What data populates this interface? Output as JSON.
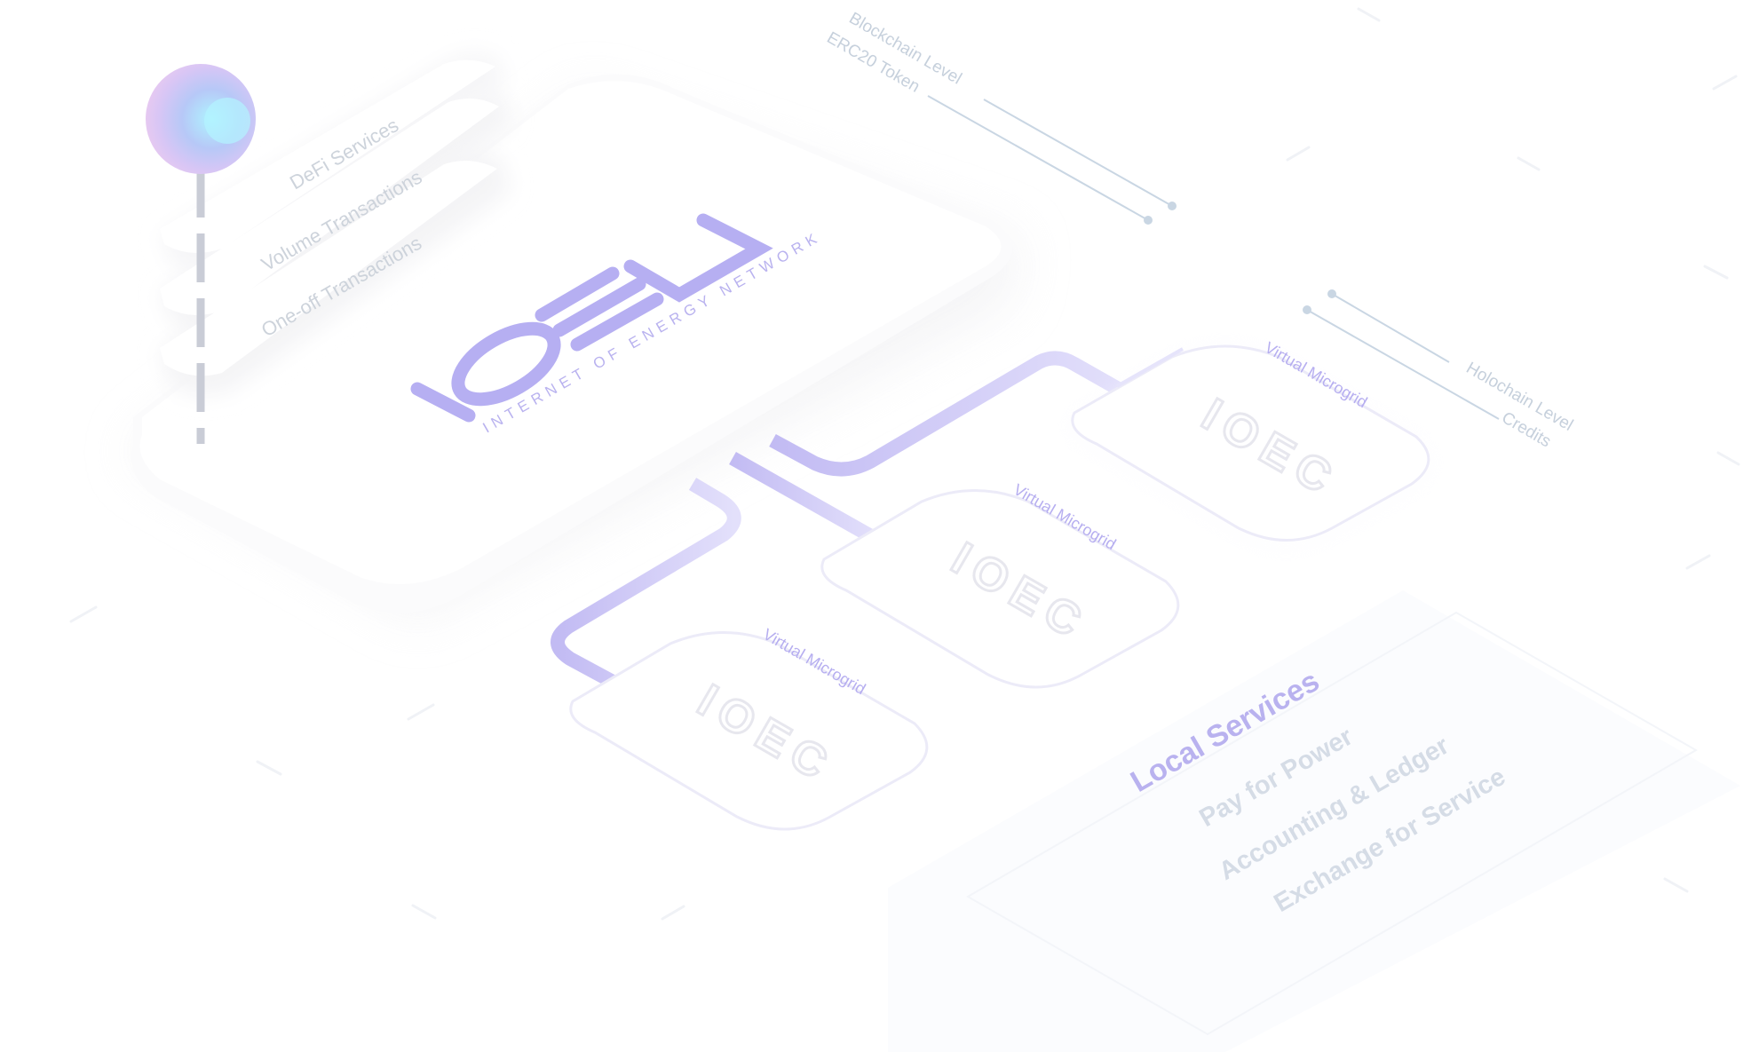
{
  "brand": {
    "logo_text": "IOEN",
    "tagline": "INTERNET OF ENERGY NETWORK"
  },
  "stack_items": [
    {
      "label": "DeFi Services"
    },
    {
      "label": "Volume Transactions"
    },
    {
      "label": "One-off Transactions"
    }
  ],
  "blockchain": {
    "level_label": "Blockchain Level",
    "token_label": "ERC20 Token"
  },
  "holochain": {
    "level_label": "Holochain Level",
    "token_label": "Credits"
  },
  "microgrids": [
    {
      "label": "Virtual Microgrid",
      "logo_text": "IOEC"
    },
    {
      "label": "Virtual Microgrid",
      "logo_text": "IOEC"
    },
    {
      "label": "Virtual Microgrid",
      "logo_text": "IOEC"
    }
  ],
  "local_services": {
    "title": "Local Services",
    "items": [
      "Pay for Power",
      "Accounting & Ledger",
      "Exchange for Service"
    ]
  },
  "colors": {
    "accent": "#b9b2f0",
    "accent_dark": "#a59cf0",
    "muted_text": "#c6d0dc",
    "line": "#c9d6e3",
    "card_stroke": "#ecebf8"
  }
}
